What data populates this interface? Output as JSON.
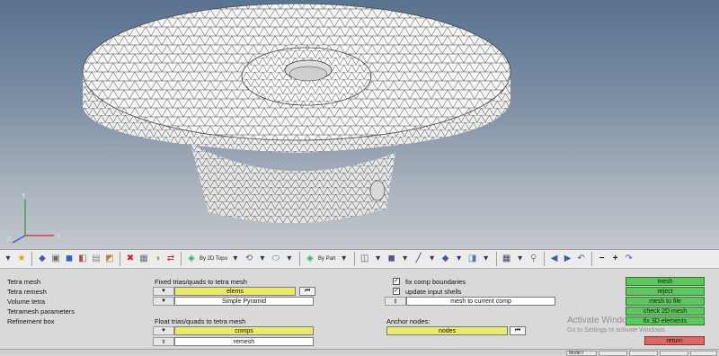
{
  "toolbar": {
    "topo_label": "By 2D Topo",
    "part_label": "By Part"
  },
  "menu": {
    "items": [
      "Tetra mesh",
      "Tetra remesh",
      "Volume tetra",
      "Tetramesh parameters",
      "Refinement box"
    ]
  },
  "fixed": {
    "heading": "Fixed trias/quads to tetra mesh",
    "elems_value": "elems",
    "pyramid_value": "Simple Pyramid"
  },
  "float": {
    "heading": "Float trias/quads to tetra mesh",
    "comps_value": "comps",
    "remesh_value": "remesh"
  },
  "options": {
    "fix_comp_boundaries": "fix comp boundaries",
    "update_input_shells": "update input shells",
    "mesh_to_current_comp": "mesh to current comp"
  },
  "anchor": {
    "heading": "Anchor nodes:",
    "nodes_value": "nodes"
  },
  "actions": {
    "mesh": "mesh",
    "reject": "reject",
    "mesh_to_file": "mesh to file",
    "check_2d_mesh": "check 2D mesh",
    "fix_3d_elements": "fix 3D elements",
    "return": "return"
  },
  "triad": {
    "x": "X",
    "y": "Y",
    "z": "Z"
  },
  "watermark": {
    "title": "Activate Windows",
    "subtitle": "Go to Settings to activate Windows."
  },
  "status": {
    "cell1": "Model I"
  },
  "colors": {
    "action_green": "#5fc65f",
    "return_red": "#d86a6a",
    "field_yellow": "#eaea70"
  }
}
